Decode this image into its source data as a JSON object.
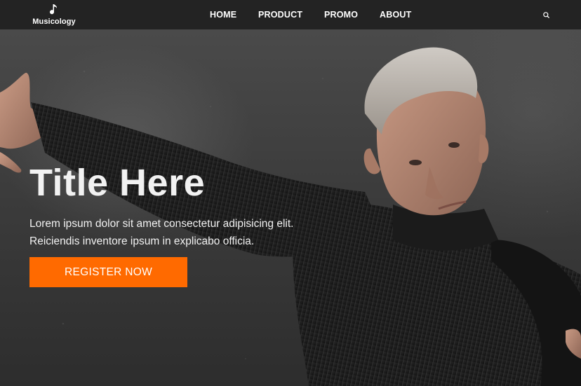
{
  "brand": {
    "name": "Musicology",
    "logo_icon": "music-note-icon"
  },
  "nav": {
    "items": [
      {
        "label": "HOME"
      },
      {
        "label": "PRODUCT"
      },
      {
        "label": "PROMO"
      },
      {
        "label": "ABOUT"
      }
    ],
    "search_icon": "search-icon"
  },
  "hero": {
    "title": "Title Here",
    "text": "Lorem ipsum dolor sit amet consectetur adipisicing elit. Reiciendis inventore ipsum in explicabo officia.",
    "cta_label": "REGISTER NOW",
    "image": "hero-photo-dancer"
  },
  "colors": {
    "navbar_bg": "#232323",
    "accent": "#ff6a00",
    "text": "#ffffff"
  }
}
